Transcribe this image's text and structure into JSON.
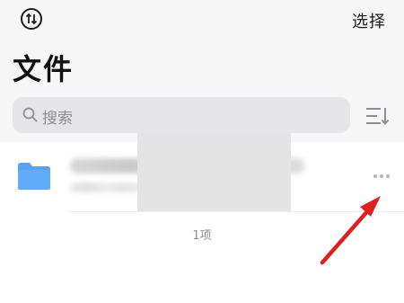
{
  "header": {
    "select_label": "选择",
    "title": "文件",
    "sync_icon": "sync-circle-icon"
  },
  "search": {
    "placeholder": "搜索",
    "icon": "search-icon",
    "sort_icon": "sort-list-icon"
  },
  "file_list": {
    "items": [
      {
        "icon": "folder-icon",
        "name": "",
        "details": "",
        "more_icon": "ellipsis-icon"
      }
    ],
    "count_label": "1项"
  },
  "colors": {
    "accent_folder": "#5aa1f2",
    "annotation_arrow": "#e02020"
  }
}
